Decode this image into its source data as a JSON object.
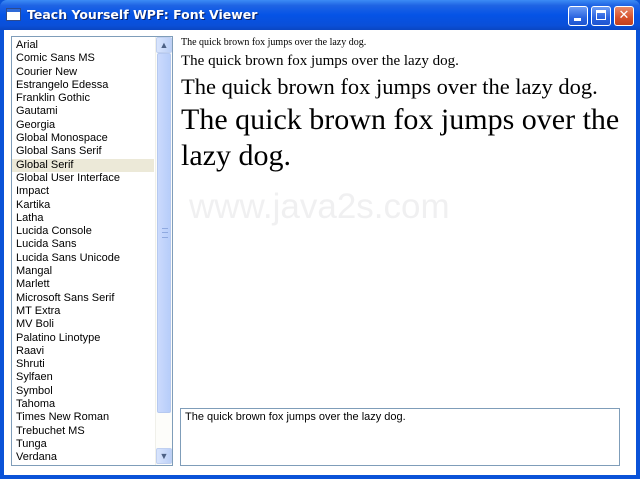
{
  "window": {
    "title": "Teach Yourself WPF: Font Viewer",
    "minimize_glyph": "",
    "maximize_glyph": "",
    "close_glyph": "✕"
  },
  "font_list": {
    "items": [
      "Arial",
      "Comic Sans MS",
      "Courier New",
      "Estrangelo Edessa",
      "Franklin Gothic",
      "Gautami",
      "Georgia",
      "Global Monospace",
      "Global Sans Serif",
      "Global Serif",
      "Global User Interface",
      "Impact",
      "Kartika",
      "Latha",
      "Lucida Console",
      "Lucida Sans",
      "Lucida Sans Unicode",
      "Mangal",
      "Marlett",
      "Microsoft Sans Serif",
      "MT Extra",
      "MV Boli",
      "Palatino Linotype",
      "Raavi",
      "Shruti",
      "Sylfaen",
      "Symbol",
      "Tahoma",
      "Times New Roman",
      "Trebuchet MS",
      "Tunga",
      "Verdana"
    ],
    "selected": "Global Serif",
    "scroll_up_glyph": "▲",
    "scroll_down_glyph": "▼"
  },
  "preview": {
    "line1": "The quick brown fox jumps over the lazy dog.",
    "line2": "The quick brown fox jumps over the lazy dog.",
    "line3": "The quick brown fox jumps over the lazy dog.",
    "line4": "The quick brown fox jumps over the lazy dog."
  },
  "watermark": "www.java2s.com",
  "sample_textbox": {
    "value": "The quick brown fox jumps over the lazy dog."
  },
  "colors": {
    "titlebar": "#0553e6",
    "selection": "#ece9d8",
    "close_button": "#d6502a"
  }
}
